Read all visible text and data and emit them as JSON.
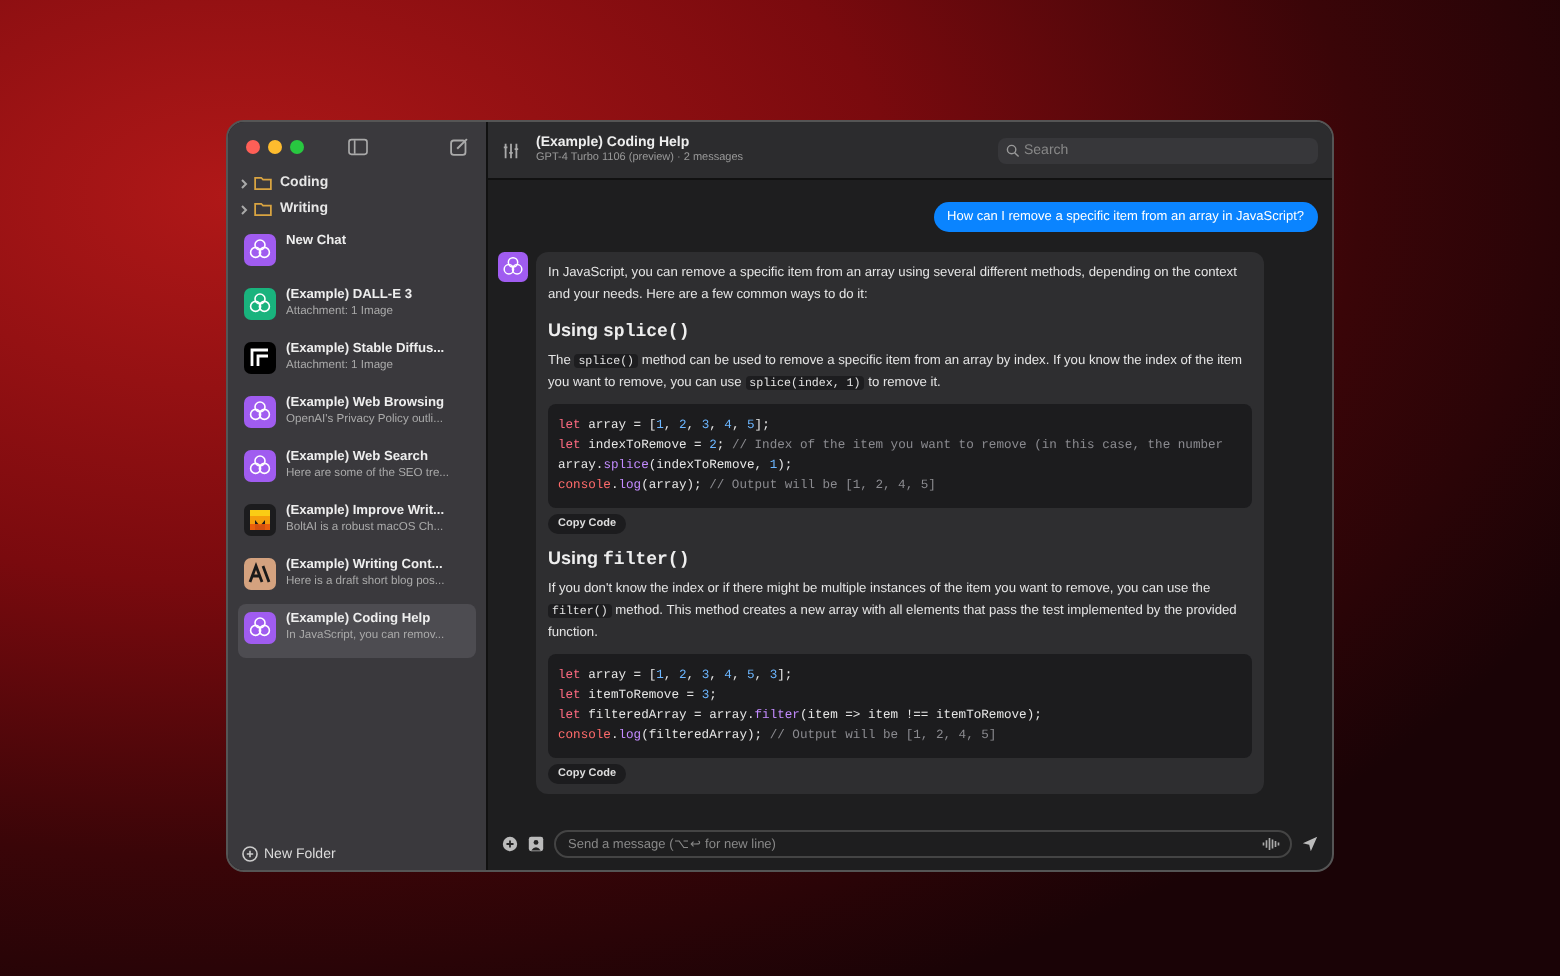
{
  "sidebar": {
    "folders": [
      {
        "name": "Coding",
        "expanded": false
      },
      {
        "name": "Writing",
        "expanded": false
      }
    ],
    "chats": [
      {
        "title": "New Chat",
        "kind": "knot",
        "color": "#a05cf0",
        "selected": false
      },
      {
        "title": "(Example) DALL-E 3",
        "subtitle": "Attachment: 1 Image",
        "kind": "knot",
        "color": "#19b37d",
        "selected": false
      },
      {
        "title": "(Example) Stable Diffus...",
        "subtitle": "Attachment: 1 Image",
        "kind": "square-f",
        "color": "#000000",
        "selected": false
      },
      {
        "title": "(Example) Web Browsing",
        "subtitle": "OpenAI's Privacy Policy outli...",
        "kind": "knot",
        "color": "#a05cf0",
        "selected": false
      },
      {
        "title": "(Example) Web Search",
        "subtitle": "Here are some of the SEO tre...",
        "kind": "knot",
        "color": "#a05cf0",
        "selected": false
      },
      {
        "title": "(Example) Improve Writ...",
        "subtitle": "BoltAI is a robust macOS Ch...",
        "kind": "m-blocks",
        "color": "#1c1c1e",
        "selected": false
      },
      {
        "title": "(Example) Writing Cont...",
        "subtitle": "Here is a draft short blog pos...",
        "kind": "a-letter",
        "color": "#d4a27f",
        "selected": false
      },
      {
        "title": "(Example) Coding Help",
        "subtitle": "In JavaScript, you can remov...",
        "kind": "knot",
        "color": "#a05cf0",
        "selected": true
      }
    ],
    "new_folder": "New Folder"
  },
  "header": {
    "title": "(Example) Coding Help",
    "subtitle": "GPT-4 Turbo 1106 (preview) · 2 messages",
    "search_placeholder": "Search"
  },
  "messages": [
    {
      "kind": "user",
      "text": "How can I remove a specific item from an array in JavaScript?"
    },
    {
      "kind": "assistant",
      "blocks": [
        {
          "kind": "paragraph",
          "parts": [
            {
              "text": "In JavaScript, you can remove a specific item from an array using several different methods, depending on the context and your needs. Here are a few common ways to do it:",
              "code": false
            }
          ]
        },
        {
          "kind": "heading",
          "parts": [
            {
              "text": "Using ",
              "code": false
            },
            {
              "text": "splice()",
              "code": true
            }
          ]
        },
        {
          "kind": "paragraph",
          "parts": [
            {
              "text": "The ",
              "code": false
            },
            {
              "text": "splice()",
              "code": true
            },
            {
              "text": " method can be used to remove a specific item from an array by index. If you know the index of the item you want to remove, you can use ",
              "code": false
            },
            {
              "text": "splice(index, 1)",
              "code": true
            },
            {
              "text": " to remove it.",
              "code": false
            }
          ]
        },
        {
          "kind": "code",
          "copy_label": "Copy Code",
          "lines": [
            [
              {
                "kind": "keyword",
                "text": "let"
              },
              {
                "kind": "plain",
                "text": " array = ["
              },
              {
                "kind": "number",
                "text": "1"
              },
              {
                "kind": "plain",
                "text": ", "
              },
              {
                "kind": "number",
                "text": "2"
              },
              {
                "kind": "plain",
                "text": ", "
              },
              {
                "kind": "number",
                "text": "3"
              },
              {
                "kind": "plain",
                "text": ", "
              },
              {
                "kind": "number",
                "text": "4"
              },
              {
                "kind": "plain",
                "text": ", "
              },
              {
                "kind": "number",
                "text": "5"
              },
              {
                "kind": "plain",
                "text": "];"
              }
            ],
            [
              {
                "kind": "keyword",
                "text": "let"
              },
              {
                "kind": "plain",
                "text": " indexToRemove = "
              },
              {
                "kind": "number",
                "text": "2"
              },
              {
                "kind": "plain",
                "text": "; "
              },
              {
                "kind": "comment",
                "text": "// Index of the item you want to remove (in this case, the number"
              }
            ],
            [
              {
                "kind": "plain",
                "text": "array."
              },
              {
                "kind": "function",
                "text": "splice"
              },
              {
                "kind": "plain",
                "text": "(indexToRemove, "
              },
              {
                "kind": "number",
                "text": "1"
              },
              {
                "kind": "plain",
                "text": ");"
              }
            ],
            [
              {
                "kind": "object",
                "text": "console"
              },
              {
                "kind": "plain",
                "text": "."
              },
              {
                "kind": "function",
                "text": "log"
              },
              {
                "kind": "plain",
                "text": "(array); "
              },
              {
                "kind": "comment",
                "text": "// Output will be [1, 2, 4, 5]"
              }
            ]
          ]
        },
        {
          "kind": "heading",
          "parts": [
            {
              "text": "Using ",
              "code": false
            },
            {
              "text": "filter()",
              "code": true
            }
          ]
        },
        {
          "kind": "paragraph",
          "parts": [
            {
              "text": "If you don't know the index or if there might be multiple instances of the item you want to remove, you can use the ",
              "code": false
            },
            {
              "text": "filter()",
              "code": true
            },
            {
              "text": " method. This method creates a new array with all elements that pass the test implemented by the provided function.",
              "code": false
            }
          ]
        },
        {
          "kind": "code",
          "copy_label": "Copy Code",
          "lines": [
            [
              {
                "kind": "keyword",
                "text": "let"
              },
              {
                "kind": "plain",
                "text": " array = ["
              },
              {
                "kind": "number",
                "text": "1"
              },
              {
                "kind": "plain",
                "text": ", "
              },
              {
                "kind": "number",
                "text": "2"
              },
              {
                "kind": "plain",
                "text": ", "
              },
              {
                "kind": "number",
                "text": "3"
              },
              {
                "kind": "plain",
                "text": ", "
              },
              {
                "kind": "number",
                "text": "4"
              },
              {
                "kind": "plain",
                "text": ", "
              },
              {
                "kind": "number",
                "text": "5"
              },
              {
                "kind": "plain",
                "text": ", "
              },
              {
                "kind": "number",
                "text": "3"
              },
              {
                "kind": "plain",
                "text": "];"
              }
            ],
            [
              {
                "kind": "keyword",
                "text": "let"
              },
              {
                "kind": "plain",
                "text": " itemToRemove = "
              },
              {
                "kind": "number",
                "text": "3"
              },
              {
                "kind": "plain",
                "text": ";"
              }
            ],
            [
              {
                "kind": "keyword",
                "text": "let"
              },
              {
                "kind": "plain",
                "text": " filteredArray = array."
              },
              {
                "kind": "function",
                "text": "filter"
              },
              {
                "kind": "plain",
                "text": "(item => item !== itemToRemove);"
              }
            ],
            [
              {
                "kind": "object",
                "text": "console"
              },
              {
                "kind": "plain",
                "text": "."
              },
              {
                "kind": "function",
                "text": "log"
              },
              {
                "kind": "plain",
                "text": "(filteredArray); "
              },
              {
                "kind": "comment",
                "text": "// Output will be [1, 2, 4, 5]"
              }
            ]
          ]
        }
      ]
    }
  ],
  "composer": {
    "placeholder": "Send a message (⌥↩ for new line)"
  }
}
